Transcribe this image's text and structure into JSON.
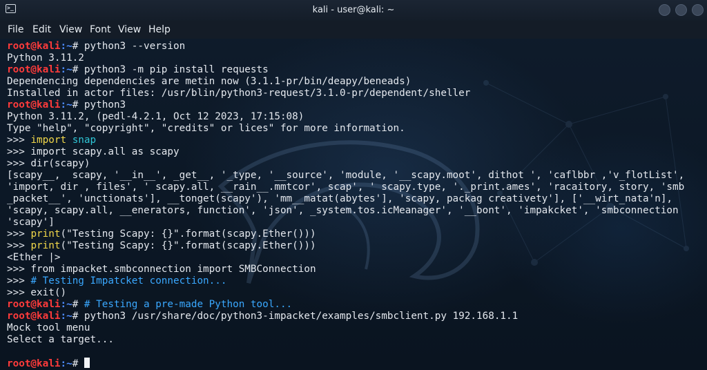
{
  "window": {
    "title": "kali - user@kali: ~",
    "icon": "terminal-icon",
    "buttons": [
      "minimize-button",
      "maximize-button",
      "close-button"
    ]
  },
  "menu": [
    "File",
    "Edit",
    "View",
    "Font",
    "View",
    "Help"
  ],
  "prompt": {
    "user_host": "root@kali",
    "path": ":~",
    "symbol": "# "
  },
  "lines": [
    {
      "type": "prompt",
      "cmd": "python3 --version"
    },
    {
      "type": "out",
      "text": "Python 3.11.2"
    },
    {
      "type": "prompt",
      "cmd": "python3 -m pip install requests"
    },
    {
      "type": "out",
      "text": "Dependencing dependencies are metin now (3.1.1-pr/bin/deapy/beneads)"
    },
    {
      "type": "out",
      "text": "Installed in actor files: /usr/blin/python3-request/3.1.0-pr/dependent/sheller"
    },
    {
      "type": "prompt",
      "cmd": "python3"
    },
    {
      "type": "out",
      "text": "Python 3.11.2, (pedl-4.2.1, Oct 12 2023, 17:15:08)"
    },
    {
      "type": "out",
      "text": "Type \"help\", \"copyright\", \"credits\" or lices\" for more information."
    },
    {
      "type": "py",
      "kw": "import",
      "rest": " ",
      "mod": "snap"
    },
    {
      "type": "out",
      "text": ">>> import scapy.all as scapy"
    },
    {
      "type": "out",
      "text": ">>> dir(scapy)"
    },
    {
      "type": "out",
      "text": "[scapy__,  scapy, '__in__', _get__, '_type, '__source', 'module, '__scapy.moot', dithot ', 'caflbbr ,'v_flotList',"
    },
    {
      "type": "out",
      "text": "'import, dir , files', ' scapy.all, __rain__.mmtcor', scap', ' scapy.type, '._print.ames', 'racaitory, story, 'smb"
    },
    {
      "type": "out",
      "text": "_packet__', 'unctionats'], __tonget(scapy'), 'mm__matat(abytes'], 'scapy, packag creativety'], ['__wirt_nata'n],"
    },
    {
      "type": "out",
      "text": "'scapy, scapy.all, __enerators, function', 'json', _system.tos.icMeanager', '__bont', 'impakcket', 'smbconnection"
    },
    {
      "type": "out",
      "text": "'scapy']"
    },
    {
      "type": "print",
      "text": "(\"Testing Scapy: {}\".format(scapy.Ether()))"
    },
    {
      "type": "print",
      "text": "(\"Testing Scapy: {}\".format(scapy.Ether()))"
    },
    {
      "type": "out",
      "text": "<Ether |>"
    },
    {
      "type": "out",
      "text": ">>> from impacket.smbconnection import SMBConnection"
    },
    {
      "type": "pycomment",
      "text": "# Testing Impatcket connection..."
    },
    {
      "type": "out",
      "text": ">>> exit()"
    },
    {
      "type": "promptcomment",
      "cmd": "# Testing a pre-made Python tool..."
    },
    {
      "type": "prompt",
      "cmd": "python3 /usr/share/doc/python3-impacket/examples/smbclient.py 192.168.1.1"
    },
    {
      "type": "out",
      "text": "Mock tool menu"
    },
    {
      "type": "out",
      "text": "Select a target..."
    },
    {
      "type": "blank"
    },
    {
      "type": "cursor"
    }
  ],
  "py_prompt": ">>> ",
  "print_kw": "print",
  "colors": {
    "user": "#ff3b3b",
    "path": "#4e8cff",
    "keyword": "#f2d84a",
    "module": "#2fc6d6",
    "comment": "#3aa8ff",
    "text": "#e4e8ee"
  }
}
